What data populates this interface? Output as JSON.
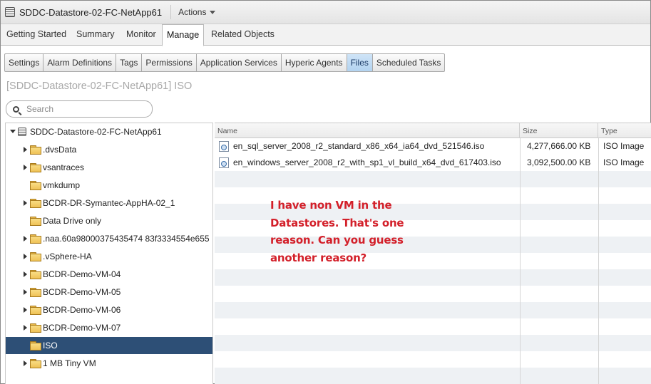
{
  "title": {
    "text": "SDDC-Datastore-02-FC-NetApp61",
    "actions_label": "Actions"
  },
  "main_tabs": [
    {
      "label": "Getting Started"
    },
    {
      "label": "Summary"
    },
    {
      "label": "Monitor"
    },
    {
      "label": "Manage",
      "active": true
    },
    {
      "label": "Related Objects"
    }
  ],
  "sub_tabs": [
    {
      "label": "Settings"
    },
    {
      "label": "Alarm Definitions"
    },
    {
      "label": "Tags"
    },
    {
      "label": "Permissions"
    },
    {
      "label": "Application Services"
    },
    {
      "label": "Hyperic Agents"
    },
    {
      "label": "Files",
      "active": true
    },
    {
      "label": "Scheduled Tasks"
    }
  ],
  "breadcrumb": "[SDDC-Datastore-02-FC-NetApp61] ISO",
  "search": {
    "placeholder": "Search"
  },
  "tree": {
    "root": "SDDC-Datastore-02-FC-NetApp61",
    "items": [
      {
        "label": ".dvsData",
        "expandable": true
      },
      {
        "label": "vsantraces",
        "expandable": true
      },
      {
        "label": "vmkdump",
        "expandable": false
      },
      {
        "label": "BCDR-DR-Symantec-AppHA-02_1",
        "expandable": true
      },
      {
        "label": "Data Drive only",
        "expandable": false
      },
      {
        "label": ".naa.60a98000375435474 83f3334554e655",
        "expandable": true
      },
      {
        "label": ".vSphere-HA",
        "expandable": true
      },
      {
        "label": "BCDR-Demo-VM-04",
        "expandable": true
      },
      {
        "label": "BCDR-Demo-VM-05",
        "expandable": true
      },
      {
        "label": "BCDR-Demo-VM-06",
        "expandable": true
      },
      {
        "label": "BCDR-Demo-VM-07",
        "expandable": true
      },
      {
        "label": "ISO",
        "expandable": false,
        "selected": true
      },
      {
        "label": "1 MB Tiny VM",
        "expandable": true
      }
    ]
  },
  "files": {
    "columns": [
      "Name",
      "Size",
      "Type"
    ],
    "rows": [
      {
        "name": "en_sql_server_2008_r2_standard_x86_x64_ia64_dvd_521546.iso",
        "size": "4,277,666.00 KB",
        "type": "ISO Image"
      },
      {
        "name": "en_windows_server_2008_r2_with_sp1_vl_build_x64_dvd_617403.iso",
        "size": "3,092,500.00 KB",
        "type": "ISO Image"
      }
    ]
  },
  "annotation": "I have non VM in the\nDatastores. That's one\nreason. Can you guess\nanother reason?",
  "colors": {
    "selection": "#2d4f76",
    "annotation": "#d3202a",
    "active_subtab": "#b3d3f0"
  }
}
